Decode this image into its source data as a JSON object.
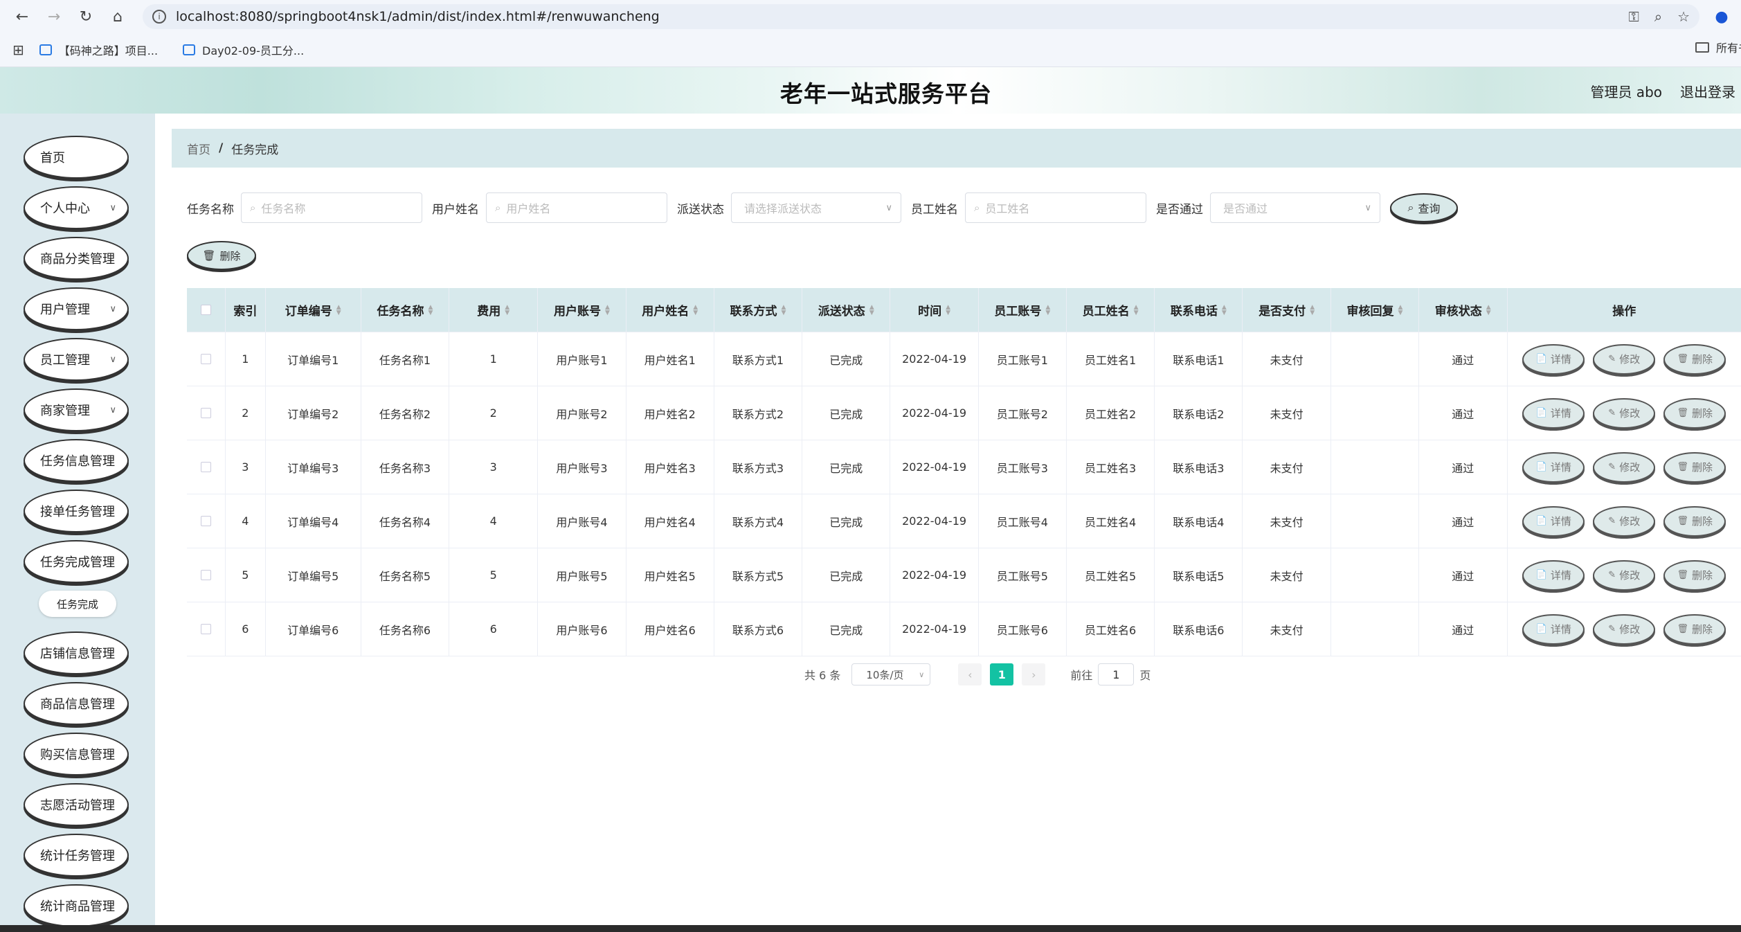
{
  "browser": {
    "url": "localhost:8080/springboot4nsk1/admin/dist/index.html#/renwuwancheng",
    "bookmarks": [
      "【码神之路】项目...",
      "Day02-09-员工分..."
    ],
    "bookmarks_right": "所有书"
  },
  "header": {
    "title": "老年一站式服务平台",
    "user": "管理员 abo",
    "logout": "退出登录"
  },
  "sidebar": {
    "items": [
      {
        "label": "首页",
        "chevron": false
      },
      {
        "label": "个人中心",
        "chevron": true
      },
      {
        "label": "商品分类管理",
        "chevron": false
      },
      {
        "label": "用户管理",
        "chevron": true
      },
      {
        "label": "员工管理",
        "chevron": true
      },
      {
        "label": "商家管理",
        "chevron": true
      },
      {
        "label": "任务信息管理",
        "chevron": false
      },
      {
        "label": "接单任务管理",
        "chevron": false
      },
      {
        "label": "任务完成管理",
        "chevron": false
      },
      {
        "label": "店铺信息管理",
        "chevron": false
      },
      {
        "label": "商品信息管理",
        "chevron": false
      },
      {
        "label": "购买信息管理",
        "chevron": false
      },
      {
        "label": "志愿活动管理",
        "chevron": false
      },
      {
        "label": "统计任务管理",
        "chevron": false
      },
      {
        "label": "统计商品管理",
        "chevron": false
      }
    ],
    "submenu": "任务完成"
  },
  "breadcrumb": {
    "home": "首页",
    "sep": "/",
    "current": "任务完成"
  },
  "filters": {
    "task_name_label": "任务名称",
    "task_name_ph": "任务名称",
    "user_name_label": "用户姓名",
    "user_name_ph": "用户姓名",
    "dispatch_label": "派送状态",
    "dispatch_ph": "请选择派送状态",
    "emp_name_label": "员工姓名",
    "emp_name_ph": "员工姓名",
    "passed_label": "是否通过",
    "passed_ph": "是否通过",
    "query": "查询"
  },
  "delete_label": "删除",
  "table": {
    "headers": [
      "索引",
      "订单编号",
      "任务名称",
      "费用",
      "用户账号",
      "用户姓名",
      "联系方式",
      "派送状态",
      "时间",
      "员工账号",
      "员工姓名",
      "联系电话",
      "是否支付",
      "审核回复",
      "审核状态",
      "操作"
    ],
    "rows": [
      [
        "1",
        "订单编号1",
        "任务名称1",
        "1",
        "用户账号1",
        "用户姓名1",
        "联系方式1",
        "已完成",
        "2022-04-19",
        "员工账号1",
        "员工姓名1",
        "联系电话1",
        "未支付",
        "",
        "通过"
      ],
      [
        "2",
        "订单编号2",
        "任务名称2",
        "2",
        "用户账号2",
        "用户姓名2",
        "联系方式2",
        "已完成",
        "2022-04-19",
        "员工账号2",
        "员工姓名2",
        "联系电话2",
        "未支付",
        "",
        "通过"
      ],
      [
        "3",
        "订单编号3",
        "任务名称3",
        "3",
        "用户账号3",
        "用户姓名3",
        "联系方式3",
        "已完成",
        "2022-04-19",
        "员工账号3",
        "员工姓名3",
        "联系电话3",
        "未支付",
        "",
        "通过"
      ],
      [
        "4",
        "订单编号4",
        "任务名称4",
        "4",
        "用户账号4",
        "用户姓名4",
        "联系方式4",
        "已完成",
        "2022-04-19",
        "员工账号4",
        "员工姓名4",
        "联系电话4",
        "未支付",
        "",
        "通过"
      ],
      [
        "5",
        "订单编号5",
        "任务名称5",
        "5",
        "用户账号5",
        "用户姓名5",
        "联系方式5",
        "已完成",
        "2022-04-19",
        "员工账号5",
        "员工姓名5",
        "联系电话5",
        "未支付",
        "",
        "通过"
      ],
      [
        "6",
        "订单编号6",
        "任务名称6",
        "6",
        "用户账号6",
        "用户姓名6",
        "联系方式6",
        "已完成",
        "2022-04-19",
        "员工账号6",
        "员工姓名6",
        "联系电话6",
        "未支付",
        "",
        "通过"
      ]
    ],
    "actions": [
      "详情",
      "修改",
      "删除"
    ]
  },
  "pagination": {
    "total": "共 6 条",
    "page_size": "10条/页",
    "current": "1",
    "goto_label": "前往",
    "goto_value": "1",
    "page_suffix": "页"
  }
}
